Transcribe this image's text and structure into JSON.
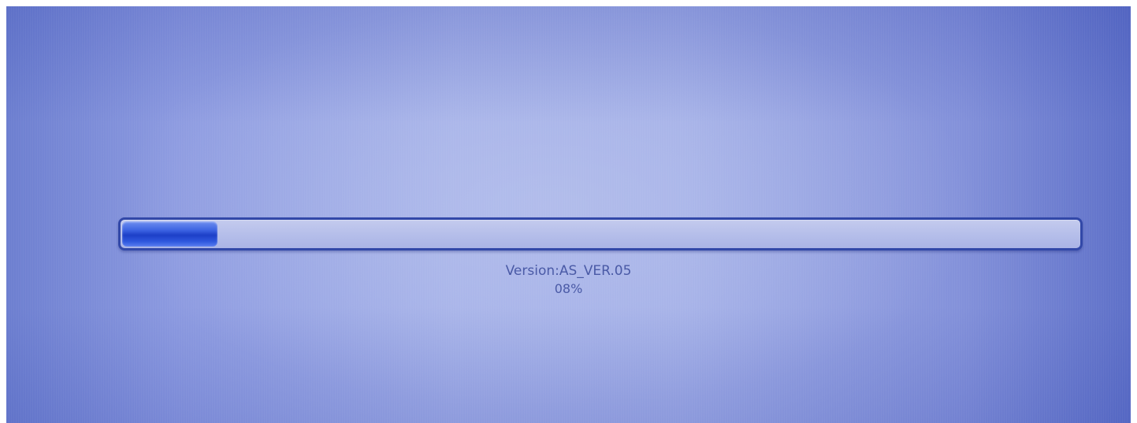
{
  "boot_screen": {
    "version_text": "Version:AS_VER.05",
    "percent_text": "08%",
    "progress_fraction": 0.1,
    "colors": {
      "background": "#9aa7e4",
      "bar_border": "#3248a8",
      "bar_fill": "#2a4fd6",
      "text": "#4a5aa6"
    }
  }
}
